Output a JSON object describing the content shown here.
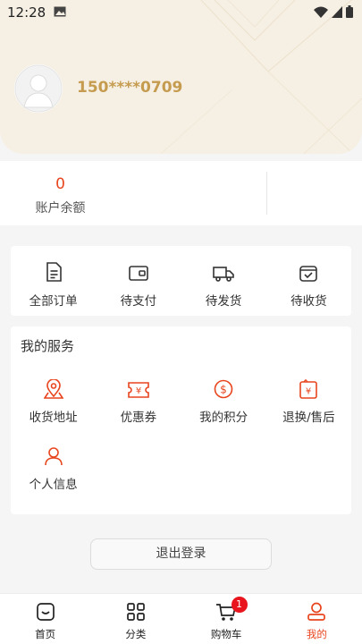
{
  "status": {
    "time": "12:28"
  },
  "user": {
    "phone": "150****0709"
  },
  "balance": {
    "value": "0",
    "label": "账户余额"
  },
  "orders": [
    {
      "label": "全部订单",
      "icon": "order-list-icon"
    },
    {
      "label": "待支付",
      "icon": "wallet-icon"
    },
    {
      "label": "待发货",
      "icon": "truck-icon"
    },
    {
      "label": "待收货",
      "icon": "package-check-icon"
    }
  ],
  "services": {
    "title": "我的服务",
    "items": [
      {
        "label": "收货地址",
        "icon": "map-pin-icon"
      },
      {
        "label": "优惠券",
        "icon": "coupon-icon"
      },
      {
        "label": "我的积分",
        "icon": "points-icon"
      },
      {
        "label": "退换/售后",
        "icon": "return-icon"
      },
      {
        "label": "个人信息",
        "icon": "person-icon"
      }
    ]
  },
  "logout_label": "退出登录",
  "tabbar": {
    "tabs": [
      {
        "label": "首页",
        "icon": "home-icon"
      },
      {
        "label": "分类",
        "icon": "category-icon"
      },
      {
        "label": "购物车",
        "icon": "cart-icon",
        "badge": "1"
      },
      {
        "label": "我的",
        "icon": "user-icon"
      }
    ]
  },
  "colors": {
    "accent": "#e8451e",
    "gold": "#c59b4f",
    "hero_bg": "#f6f0e4"
  }
}
